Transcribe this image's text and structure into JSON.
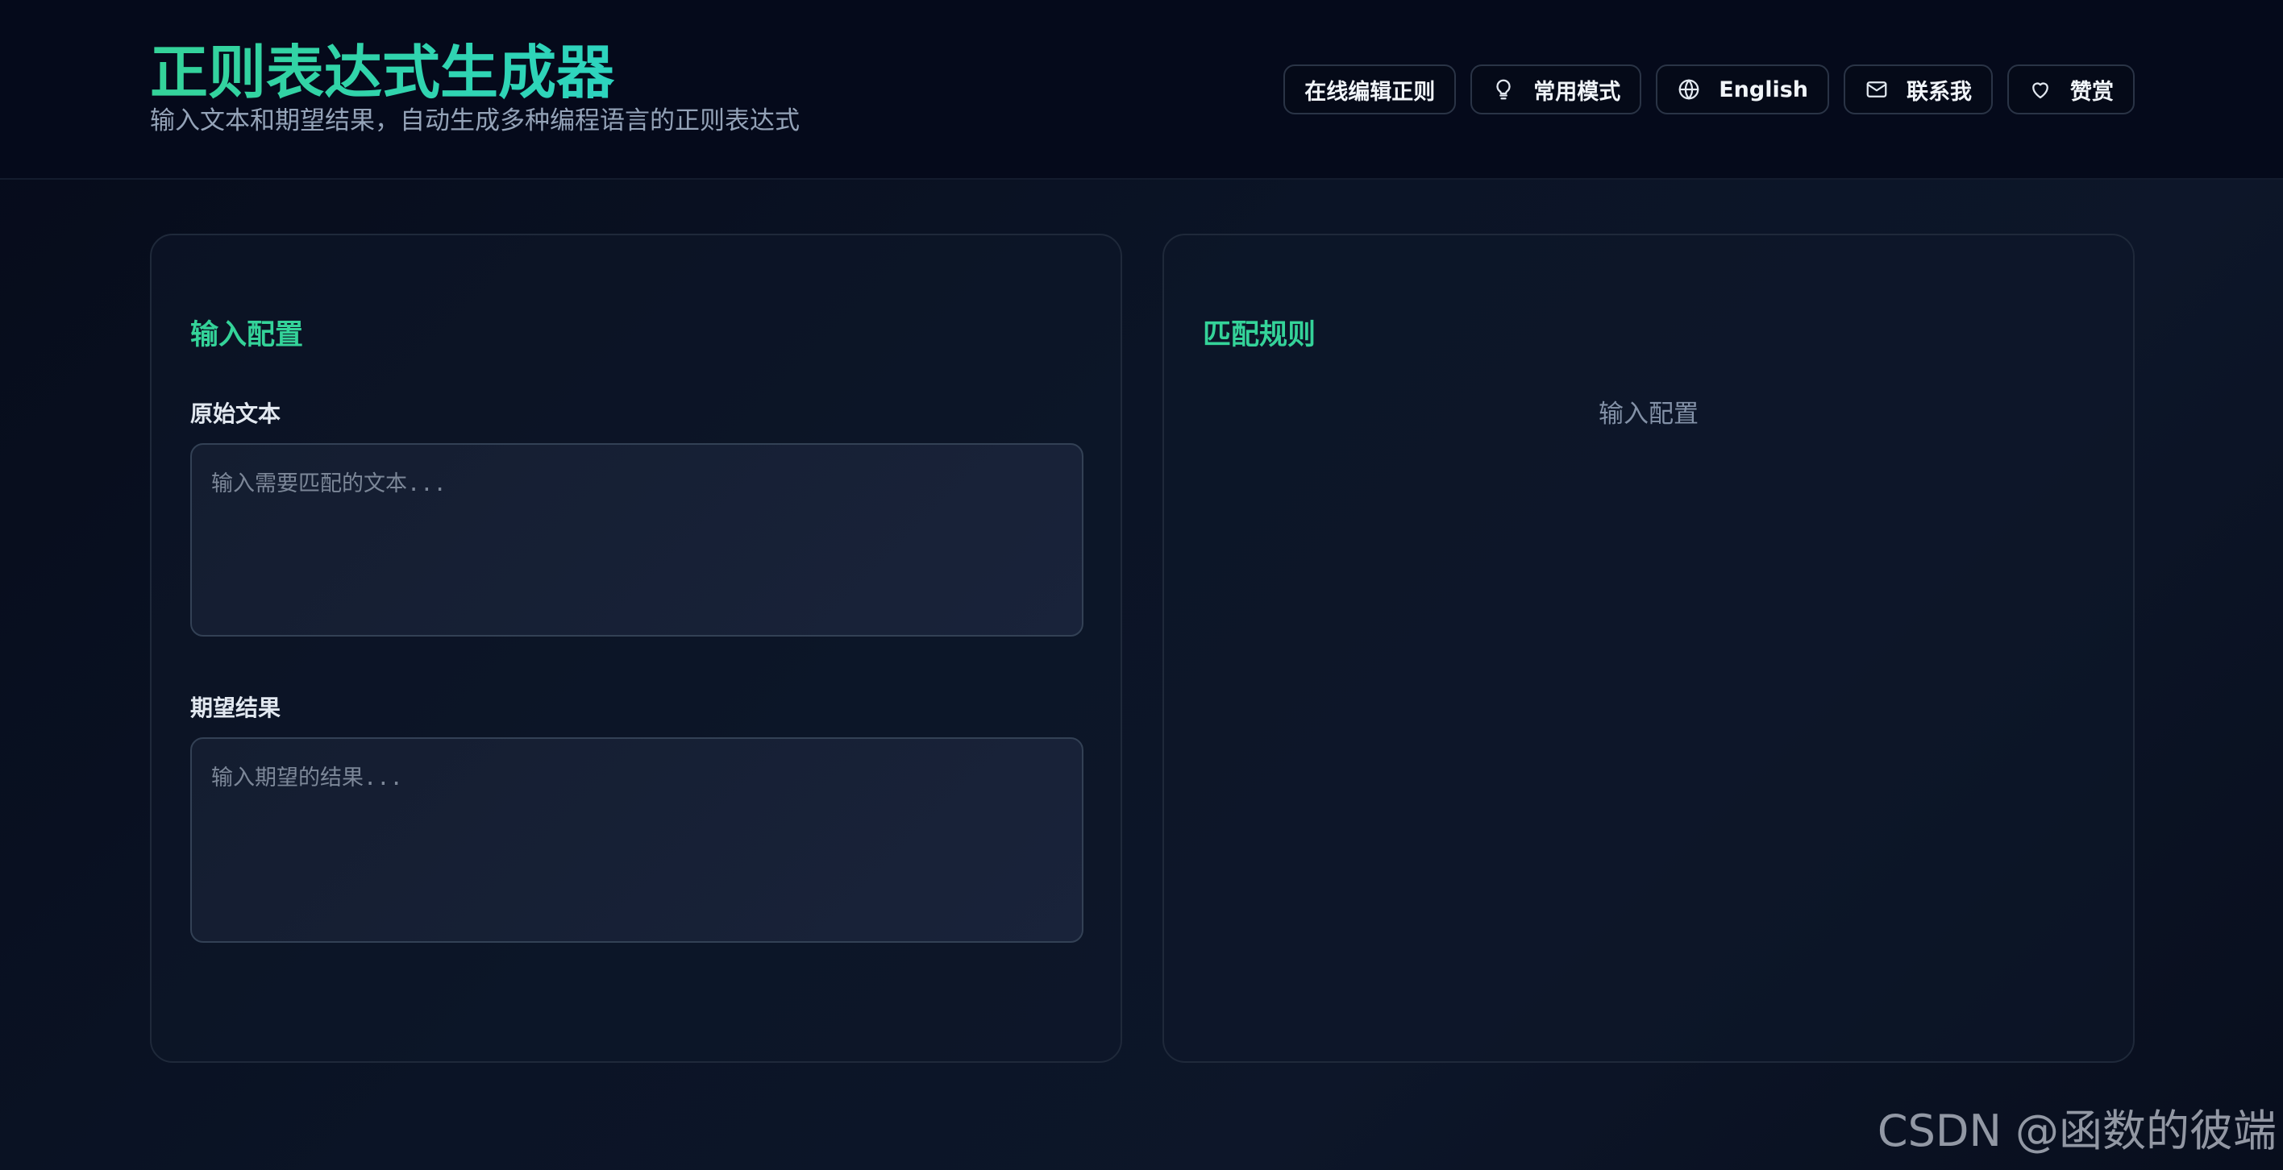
{
  "header": {
    "title": "正则表达式生成器",
    "subtitle": "输入文本和期望结果，自动生成多种编程语言的正则表达式"
  },
  "nav": {
    "edit_online": "在线编辑正则",
    "common_patterns": "常用模式",
    "language": "English",
    "contact": "联系我",
    "donate": "赞赏",
    "icons": {
      "common_patterns": "lightbulb-icon",
      "language": "globe-icon",
      "contact": "mail-icon",
      "donate": "heart-icon"
    }
  },
  "input_panel": {
    "title": "输入配置",
    "source_label": "原始文本",
    "source_value": "",
    "source_placeholder": "输入需要匹配的文本...",
    "expected_label": "期望结果",
    "expected_value": "",
    "expected_placeholder": "输入期望的结果..."
  },
  "rules_panel": {
    "title": "匹配规则",
    "empty_text": "输入配置"
  },
  "watermark": "CSDN @函数的彼端",
  "colors": {
    "accent": "#34d399",
    "accent_alt": "#2dd4bf",
    "background": "#0b1426",
    "header_bg": "#050a1b"
  }
}
